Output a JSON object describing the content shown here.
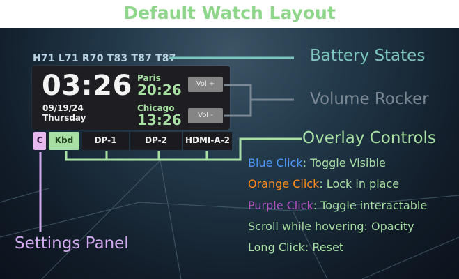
{
  "title": "Default Watch Layout",
  "battery": [
    "H71",
    "L71",
    "R70",
    "T83",
    "T87",
    "T87"
  ],
  "watch": {
    "time": "03:26",
    "date": "09/19/24",
    "weekday": "Thursday",
    "zones": [
      {
        "city": "Paris",
        "time": "20:26"
      },
      {
        "city": "Chicago",
        "time": "13:26"
      }
    ],
    "vol_up": "Vol +",
    "vol_down": "Vol -"
  },
  "tabs": {
    "settings": "C",
    "kbd": "Kbd",
    "dp1": "DP-1",
    "dp2": "DP-2",
    "hdmi": "HDMI-A-2"
  },
  "labels": {
    "battery_states": "Battery States",
    "volume_rocker": "Volume Rocker",
    "overlay_controls": "Overlay Controls",
    "settings_panel": "Settings Panel"
  },
  "help": {
    "blue_click": "Blue Click",
    "blue_action": ": Toggle Visible",
    "orange_click": "Orange Click",
    "orange_action": ": Lock in place",
    "purple_click": "Purple Click",
    "purple_action": ": Toggle interactable",
    "scroll": "Scroll while hovering: Opacity",
    "long_click": "Long Click: Reset"
  },
  "colors": {
    "title_green": "#8ed68a",
    "accent_green": "#a8e0a3",
    "battery_teal": "#7dc6bd",
    "volume_gray": "#7c8894",
    "settings_purple": "#d2a9ef",
    "blue": "#4c9bff",
    "orange": "#ff8c1a",
    "purple": "#b553c4"
  }
}
